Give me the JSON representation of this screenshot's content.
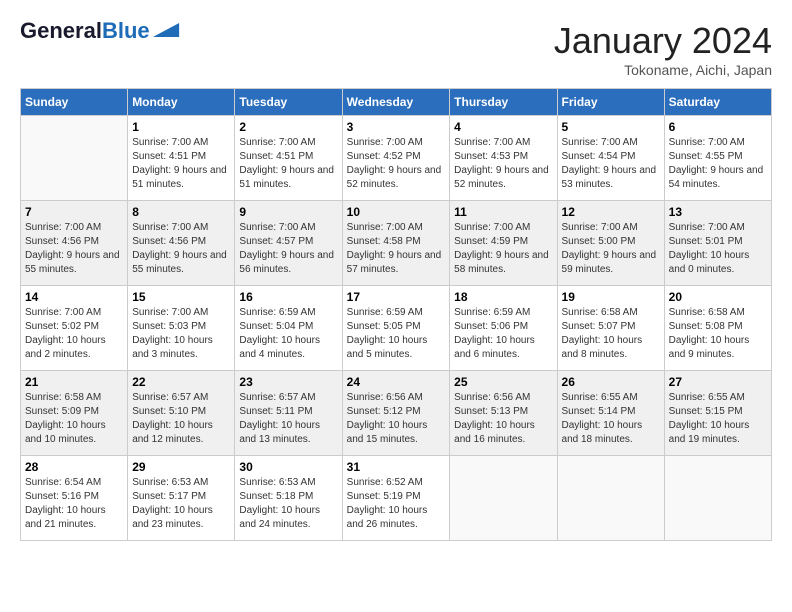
{
  "header": {
    "logo_general": "General",
    "logo_blue": "Blue",
    "month_title": "January 2024",
    "location": "Tokoname, Aichi, Japan"
  },
  "weekdays": [
    "Sunday",
    "Monday",
    "Tuesday",
    "Wednesday",
    "Thursday",
    "Friday",
    "Saturday"
  ],
  "weeks": [
    [
      {
        "day": "",
        "sunrise": "",
        "sunset": "",
        "daylight": ""
      },
      {
        "day": "1",
        "sunrise": "Sunrise: 7:00 AM",
        "sunset": "Sunset: 4:51 PM",
        "daylight": "Daylight: 9 hours and 51 minutes."
      },
      {
        "day": "2",
        "sunrise": "Sunrise: 7:00 AM",
        "sunset": "Sunset: 4:51 PM",
        "daylight": "Daylight: 9 hours and 51 minutes."
      },
      {
        "day": "3",
        "sunrise": "Sunrise: 7:00 AM",
        "sunset": "Sunset: 4:52 PM",
        "daylight": "Daylight: 9 hours and 52 minutes."
      },
      {
        "day": "4",
        "sunrise": "Sunrise: 7:00 AM",
        "sunset": "Sunset: 4:53 PM",
        "daylight": "Daylight: 9 hours and 52 minutes."
      },
      {
        "day": "5",
        "sunrise": "Sunrise: 7:00 AM",
        "sunset": "Sunset: 4:54 PM",
        "daylight": "Daylight: 9 hours and 53 minutes."
      },
      {
        "day": "6",
        "sunrise": "Sunrise: 7:00 AM",
        "sunset": "Sunset: 4:55 PM",
        "daylight": "Daylight: 9 hours and 54 minutes."
      }
    ],
    [
      {
        "day": "7",
        "sunrise": "Sunrise: 7:00 AM",
        "sunset": "Sunset: 4:56 PM",
        "daylight": "Daylight: 9 hours and 55 minutes."
      },
      {
        "day": "8",
        "sunrise": "Sunrise: 7:00 AM",
        "sunset": "Sunset: 4:56 PM",
        "daylight": "Daylight: 9 hours and 55 minutes."
      },
      {
        "day": "9",
        "sunrise": "Sunrise: 7:00 AM",
        "sunset": "Sunset: 4:57 PM",
        "daylight": "Daylight: 9 hours and 56 minutes."
      },
      {
        "day": "10",
        "sunrise": "Sunrise: 7:00 AM",
        "sunset": "Sunset: 4:58 PM",
        "daylight": "Daylight: 9 hours and 57 minutes."
      },
      {
        "day": "11",
        "sunrise": "Sunrise: 7:00 AM",
        "sunset": "Sunset: 4:59 PM",
        "daylight": "Daylight: 9 hours and 58 minutes."
      },
      {
        "day": "12",
        "sunrise": "Sunrise: 7:00 AM",
        "sunset": "Sunset: 5:00 PM",
        "daylight": "Daylight: 9 hours and 59 minutes."
      },
      {
        "day": "13",
        "sunrise": "Sunrise: 7:00 AM",
        "sunset": "Sunset: 5:01 PM",
        "daylight": "Daylight: 10 hours and 0 minutes."
      }
    ],
    [
      {
        "day": "14",
        "sunrise": "Sunrise: 7:00 AM",
        "sunset": "Sunset: 5:02 PM",
        "daylight": "Daylight: 10 hours and 2 minutes."
      },
      {
        "day": "15",
        "sunrise": "Sunrise: 7:00 AM",
        "sunset": "Sunset: 5:03 PM",
        "daylight": "Daylight: 10 hours and 3 minutes."
      },
      {
        "day": "16",
        "sunrise": "Sunrise: 6:59 AM",
        "sunset": "Sunset: 5:04 PM",
        "daylight": "Daylight: 10 hours and 4 minutes."
      },
      {
        "day": "17",
        "sunrise": "Sunrise: 6:59 AM",
        "sunset": "Sunset: 5:05 PM",
        "daylight": "Daylight: 10 hours and 5 minutes."
      },
      {
        "day": "18",
        "sunrise": "Sunrise: 6:59 AM",
        "sunset": "Sunset: 5:06 PM",
        "daylight": "Daylight: 10 hours and 6 minutes."
      },
      {
        "day": "19",
        "sunrise": "Sunrise: 6:58 AM",
        "sunset": "Sunset: 5:07 PM",
        "daylight": "Daylight: 10 hours and 8 minutes."
      },
      {
        "day": "20",
        "sunrise": "Sunrise: 6:58 AM",
        "sunset": "Sunset: 5:08 PM",
        "daylight": "Daylight: 10 hours and 9 minutes."
      }
    ],
    [
      {
        "day": "21",
        "sunrise": "Sunrise: 6:58 AM",
        "sunset": "Sunset: 5:09 PM",
        "daylight": "Daylight: 10 hours and 10 minutes."
      },
      {
        "day": "22",
        "sunrise": "Sunrise: 6:57 AM",
        "sunset": "Sunset: 5:10 PM",
        "daylight": "Daylight: 10 hours and 12 minutes."
      },
      {
        "day": "23",
        "sunrise": "Sunrise: 6:57 AM",
        "sunset": "Sunset: 5:11 PM",
        "daylight": "Daylight: 10 hours and 13 minutes."
      },
      {
        "day": "24",
        "sunrise": "Sunrise: 6:56 AM",
        "sunset": "Sunset: 5:12 PM",
        "daylight": "Daylight: 10 hours and 15 minutes."
      },
      {
        "day": "25",
        "sunrise": "Sunrise: 6:56 AM",
        "sunset": "Sunset: 5:13 PM",
        "daylight": "Daylight: 10 hours and 16 minutes."
      },
      {
        "day": "26",
        "sunrise": "Sunrise: 6:55 AM",
        "sunset": "Sunset: 5:14 PM",
        "daylight": "Daylight: 10 hours and 18 minutes."
      },
      {
        "day": "27",
        "sunrise": "Sunrise: 6:55 AM",
        "sunset": "Sunset: 5:15 PM",
        "daylight": "Daylight: 10 hours and 19 minutes."
      }
    ],
    [
      {
        "day": "28",
        "sunrise": "Sunrise: 6:54 AM",
        "sunset": "Sunset: 5:16 PM",
        "daylight": "Daylight: 10 hours and 21 minutes."
      },
      {
        "day": "29",
        "sunrise": "Sunrise: 6:53 AM",
        "sunset": "Sunset: 5:17 PM",
        "daylight": "Daylight: 10 hours and 23 minutes."
      },
      {
        "day": "30",
        "sunrise": "Sunrise: 6:53 AM",
        "sunset": "Sunset: 5:18 PM",
        "daylight": "Daylight: 10 hours and 24 minutes."
      },
      {
        "day": "31",
        "sunrise": "Sunrise: 6:52 AM",
        "sunset": "Sunset: 5:19 PM",
        "daylight": "Daylight: 10 hours and 26 minutes."
      },
      {
        "day": "",
        "sunrise": "",
        "sunset": "",
        "daylight": ""
      },
      {
        "day": "",
        "sunrise": "",
        "sunset": "",
        "daylight": ""
      },
      {
        "day": "",
        "sunrise": "",
        "sunset": "",
        "daylight": ""
      }
    ]
  ]
}
